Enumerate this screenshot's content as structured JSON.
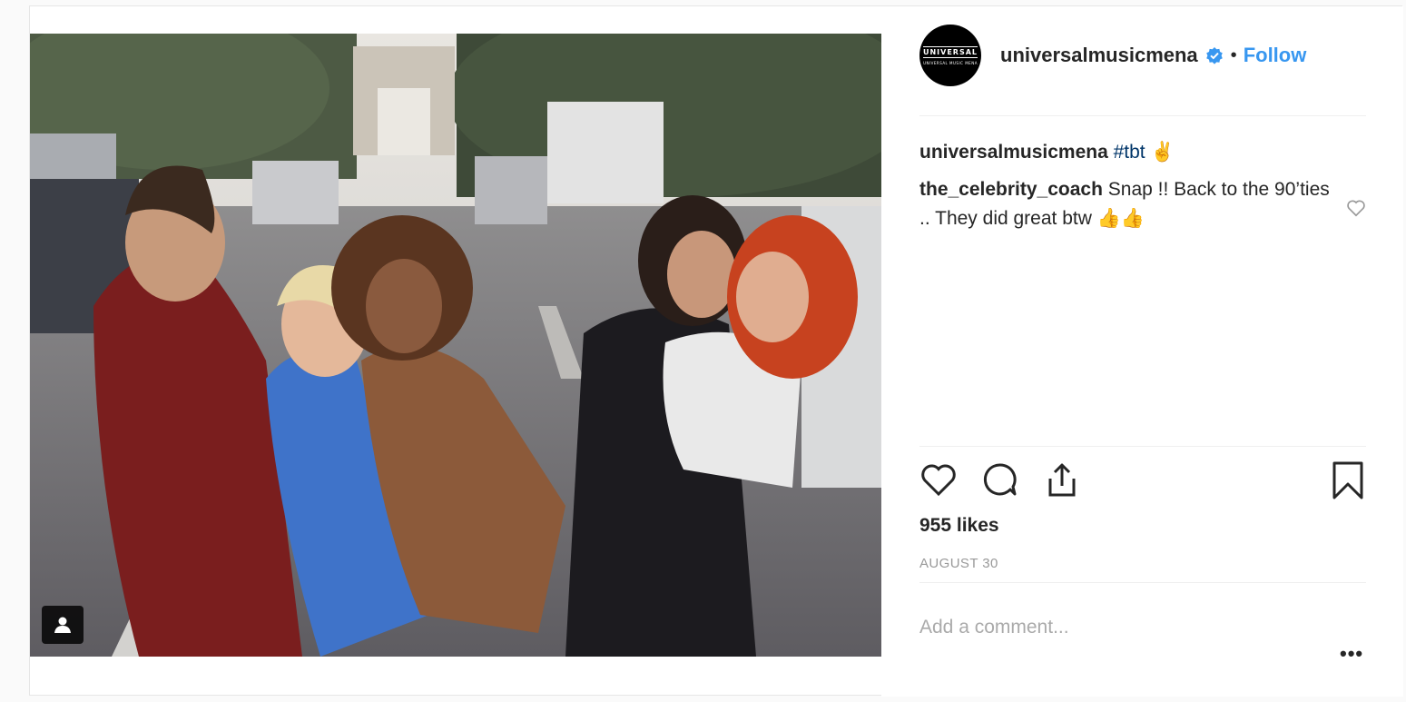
{
  "post": {
    "photo_alt": "",
    "tag_icon": "user-tag-icon"
  },
  "header": {
    "avatar_text_top": "UNIVERSAL",
    "avatar_text_bottom": "UNIVERSAL MUSIC MENA",
    "username": "universalmusicmena",
    "verified_icon": "verified-badge-icon",
    "separator": "•",
    "follow_label": "Follow"
  },
  "caption": {
    "username": "universalmusicmena",
    "hashtag": "#tbt",
    "emoji": "✌"
  },
  "comments": [
    {
      "username": "the_celebrity_coach",
      "text": "Snap !! Back to the 90’ties .. They did great btw 👍👍"
    }
  ],
  "actions": {
    "like_icon": "heart-icon",
    "comment_icon": "comment-icon",
    "share_icon": "share-icon",
    "save_icon": "bookmark-icon"
  },
  "likes": "955 likes",
  "date": "AUGUST 30",
  "comment_box": {
    "placeholder": "Add a comment..."
  },
  "more_label": "•••",
  "colors": {
    "accent": "#3897f0",
    "text": "#262626",
    "muted": "#999999",
    "hashtag": "#003569"
  }
}
